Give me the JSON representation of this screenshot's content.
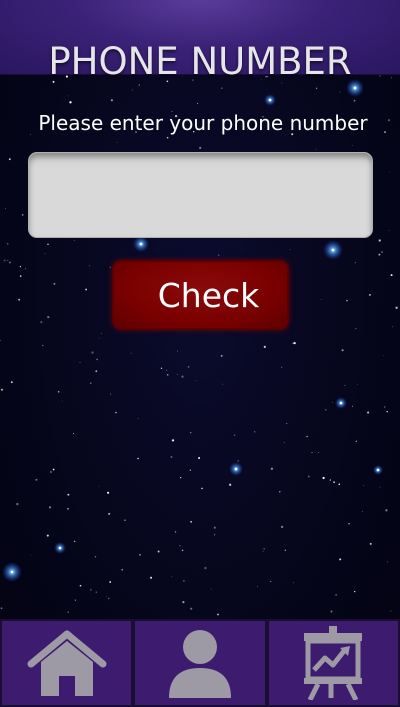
{
  "header": {
    "title": "PHONE NUMBER"
  },
  "form": {
    "prompt": "Please enter your phone number",
    "phone_value": "",
    "phone_placeholder": "",
    "check_label": "Check"
  },
  "navbar": {
    "items": [
      {
        "icon": "home-icon"
      },
      {
        "icon": "profile-icon"
      },
      {
        "icon": "chart-presentation-icon"
      }
    ]
  },
  "colors": {
    "header_purple": "#3b2277",
    "background_navy": "#06061c",
    "button_red": "#7a0000",
    "navbar_purple": "#3d1b6e",
    "icon_gray": "#9d9aa6"
  }
}
